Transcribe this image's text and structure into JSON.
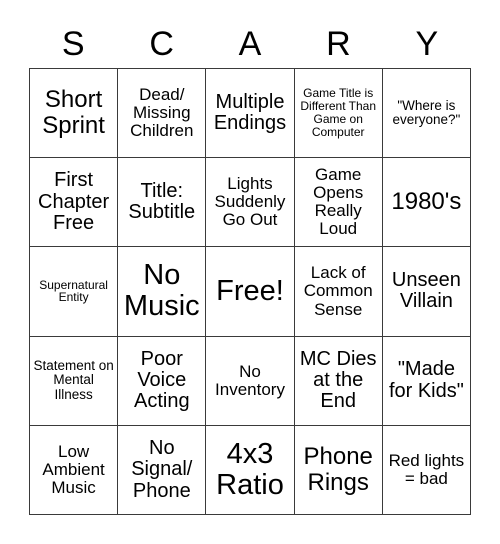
{
  "card": {
    "header_letters": [
      "S",
      "C",
      "A",
      "R",
      "Y"
    ],
    "columns": 5,
    "rows": 5,
    "border_color": "#3a3a3a",
    "background_color": "#ffffff",
    "text_color": "#000000",
    "cells": [
      {
        "text": "Short Sprint",
        "size": "fs-xl",
        "free": false
      },
      {
        "text": "Dead/ Missing Children",
        "size": "fs-m",
        "free": false
      },
      {
        "text": "Multiple Endings",
        "size": "fs-l",
        "free": false
      },
      {
        "text": "Game Title is Different Than Game on Computer",
        "size": "fs-xs",
        "free": false
      },
      {
        "text": "\"Where is everyone?\"",
        "size": "fs-s",
        "free": false
      },
      {
        "text": "First Chapter Free",
        "size": "fs-l",
        "free": false
      },
      {
        "text": "Title: Subtitle",
        "size": "fs-l",
        "free": false
      },
      {
        "text": "Lights Suddenly Go Out",
        "size": "fs-m",
        "free": false
      },
      {
        "text": "Game Opens Really Loud",
        "size": "fs-m",
        "free": false
      },
      {
        "text": "1980's",
        "size": "fs-xl",
        "free": false
      },
      {
        "text": "Supernatural Entity",
        "size": "fs-xs",
        "free": false
      },
      {
        "text": "No Music",
        "size": "fs-xxl",
        "free": false
      },
      {
        "text": "Free!",
        "size": "fs-xxl",
        "free": true
      },
      {
        "text": "Lack of Common Sense",
        "size": "fs-m",
        "free": false
      },
      {
        "text": "Unseen Villain",
        "size": "fs-l",
        "free": false
      },
      {
        "text": "Statement on Mental Illness",
        "size": "fs-s",
        "free": false
      },
      {
        "text": "Poor Voice Acting",
        "size": "fs-l",
        "free": false
      },
      {
        "text": "No Inventory",
        "size": "fs-m",
        "free": false
      },
      {
        "text": "MC Dies at the End",
        "size": "fs-l",
        "free": false
      },
      {
        "text": "\"Made for Kids\"",
        "size": "fs-l",
        "free": false
      },
      {
        "text": "Low Ambient Music",
        "size": "fs-m",
        "free": false
      },
      {
        "text": "No Signal/ Phone",
        "size": "fs-l",
        "free": false
      },
      {
        "text": "4x3 Ratio",
        "size": "fs-xxl",
        "free": false
      },
      {
        "text": "Phone Rings",
        "size": "fs-xl",
        "free": false
      },
      {
        "text": "Red lights = bad",
        "size": "fs-m",
        "free": false
      }
    ]
  }
}
